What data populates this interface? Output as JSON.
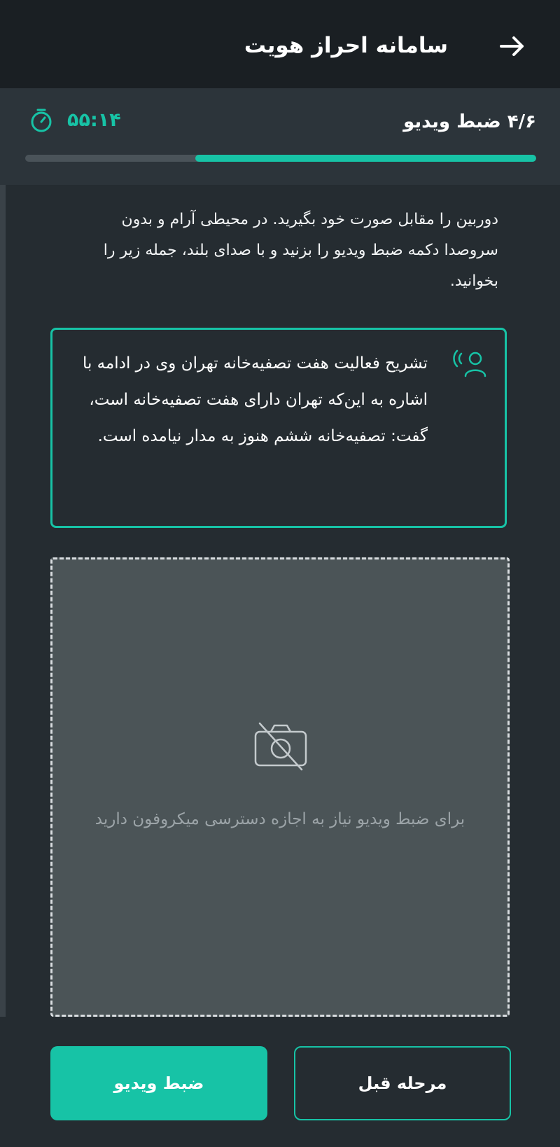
{
  "header": {
    "title": "سامانه احراز هویت",
    "back_icon": "arrow-right-icon"
  },
  "step": {
    "label": "۴/۶ ضبط ویدیو",
    "timer": "۵۵:۱۴",
    "timer_icon": "stopwatch-icon",
    "progress_fraction": 0.667
  },
  "instructions": "دوربین را مقابل صورت خود بگیرید. در محیطی آرام و بدون سروصدا دکمه ضبط ویدیو را بزنید و با صدای بلند، جمله زیر را بخوانید.",
  "quote": {
    "icon": "speaking-person-icon",
    "text": "تشریح فعالیت هفت تصفیه‌خانه تهران وی در ادامه با اشاره به این‌که تهران دارای هفت تصفیه‌خانه است، گفت: تصفیه‌خانه ششم هنوز به مدار نیامده است."
  },
  "camera": {
    "icon": "camera-off-icon",
    "permission_text": "برای ضبط ویدیو نیاز به اجازه دسترسی میکروفون دارید"
  },
  "buttons": {
    "previous": "مرحله قبل",
    "record": "ضبط ویدیو"
  },
  "colors": {
    "accent": "#17c3a6",
    "background": "#252c31",
    "header": "#1a1f23"
  }
}
